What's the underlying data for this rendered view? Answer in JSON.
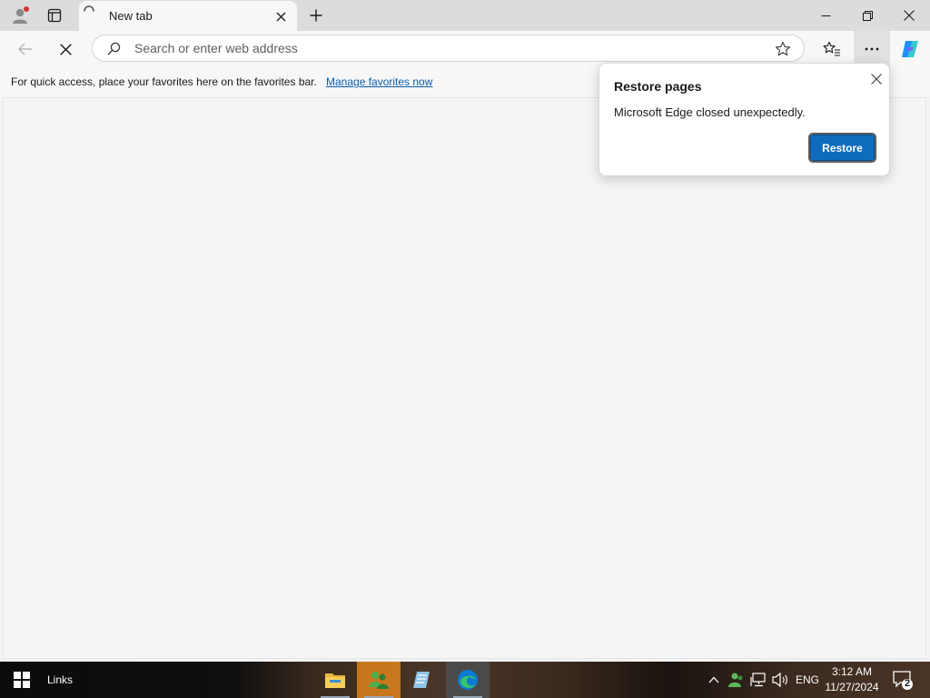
{
  "browser": {
    "tab": {
      "title": "New tab",
      "close_icon": "close-icon",
      "loading_icon": "spinner-icon"
    },
    "address_bar": {
      "placeholder": "Search or enter web address",
      "value": ""
    },
    "favorites_bar": {
      "message": "For quick access, place your favorites here on the favorites bar.",
      "link": "Manage favorites now"
    }
  },
  "popup": {
    "title": "Restore pages",
    "message": "Microsoft Edge closed unexpectedly.",
    "button": "Restore"
  },
  "taskbar": {
    "links_label": "Links",
    "language": "ENG",
    "time": "3:12 AM",
    "date": "11/27/2024",
    "notifications": "2",
    "apps": [
      "file-explorer-icon",
      "users-app-icon",
      "notepad-app-icon",
      "edge-icon"
    ]
  },
  "colors": {
    "accent": "#0f6cbd",
    "link": "#0b5cad",
    "profile_badge": "#d13438",
    "copilot": "#1e90ff"
  }
}
